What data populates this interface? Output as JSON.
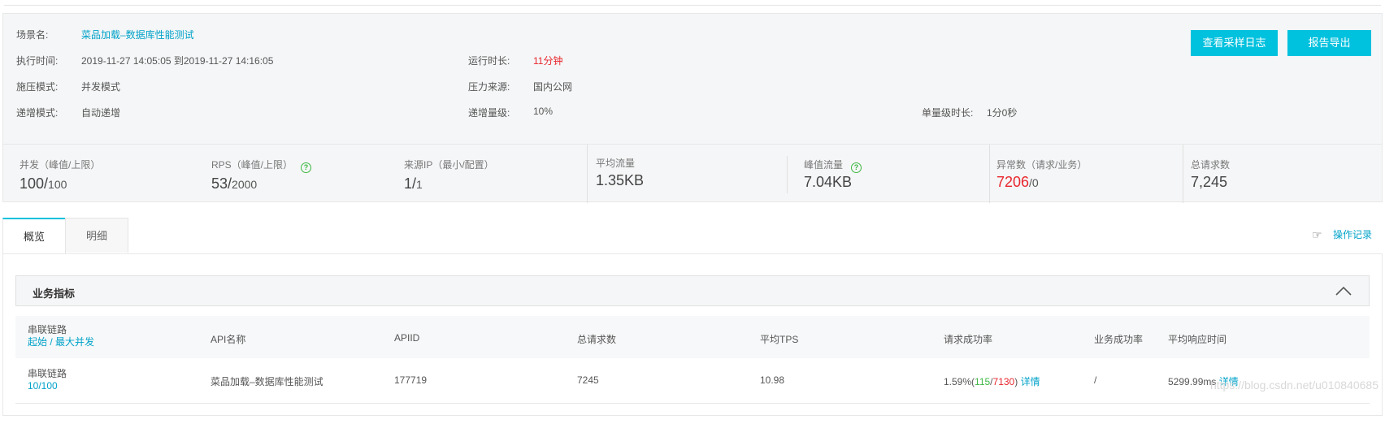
{
  "info": {
    "scene_label": "场景名:",
    "scene_value": "菜品加载–数据库性能测试",
    "exec_time_label": "执行时间:",
    "exec_time_value": "2019-11-27 14:05:05 到2019-11-27 14:16:05",
    "run_duration_label": "运行时长:",
    "run_duration_value": "11分钟",
    "pressure_mode_label": "施压模式:",
    "pressure_mode_value": "并发模式",
    "pressure_source_label": "压力来源:",
    "pressure_source_value": "国内公网",
    "ramp_mode_label": "递增模式:",
    "ramp_mode_value": "自动递增",
    "ramp_level_label": "递增量级:",
    "ramp_level_value": "10%",
    "single_level_label": "单量级时长:",
    "single_level_value": "1分0秒",
    "btn_sample_log": "查看采样日志",
    "btn_export": "报告导出"
  },
  "stats": [
    {
      "label": "并发（峰值/上限）",
      "main": "100/",
      "sub": "100"
    },
    {
      "label": "RPS（峰值/上限）",
      "main": "53/",
      "sub": "2000"
    },
    {
      "label": "来源IP（最小/配置）",
      "main": "1/",
      "sub": "1"
    },
    {
      "label": "平均流量",
      "main": "1.35KB",
      "sub": ""
    },
    {
      "label": "峰值流量",
      "main": "7.04KB",
      "sub": ""
    },
    {
      "label": "异常数（请求/业务）",
      "main": "7206",
      "sub": "/0"
    },
    {
      "label": "总请求数",
      "main": "7,245",
      "sub": ""
    }
  ],
  "tabs": [
    "概览",
    "明细"
  ],
  "oplog": "操作记录",
  "section_title": "业务指标",
  "table": {
    "headers": {
      "chain": "串联链路",
      "chain_sub": "起始 / 最大并发",
      "api_name": "API名称",
      "apiid": "APIID",
      "total_req": "总请求数",
      "avg_tps": "平均TPS",
      "req_success": "请求成功率",
      "biz_success": "业务成功率",
      "avg_resp": "平均响应时间"
    },
    "rows": [
      {
        "chain": "串联链路",
        "chain_sub": "10/100",
        "api_name": "菜品加载–数据库性能测试",
        "apiid": "177719",
        "total_req": "7245",
        "avg_tps": "10.98",
        "req_success_pct": "1.59%(",
        "req_success_ok": "115",
        "req_success_sep": "/",
        "req_success_fail": "7130",
        "req_success_close": ")",
        "req_success_link": "详情",
        "biz_success": "/",
        "avg_resp": "5299.99ms",
        "avg_resp_link": "详情"
      }
    ]
  },
  "watermark": "https://blog.csdn.net/u010840685"
}
